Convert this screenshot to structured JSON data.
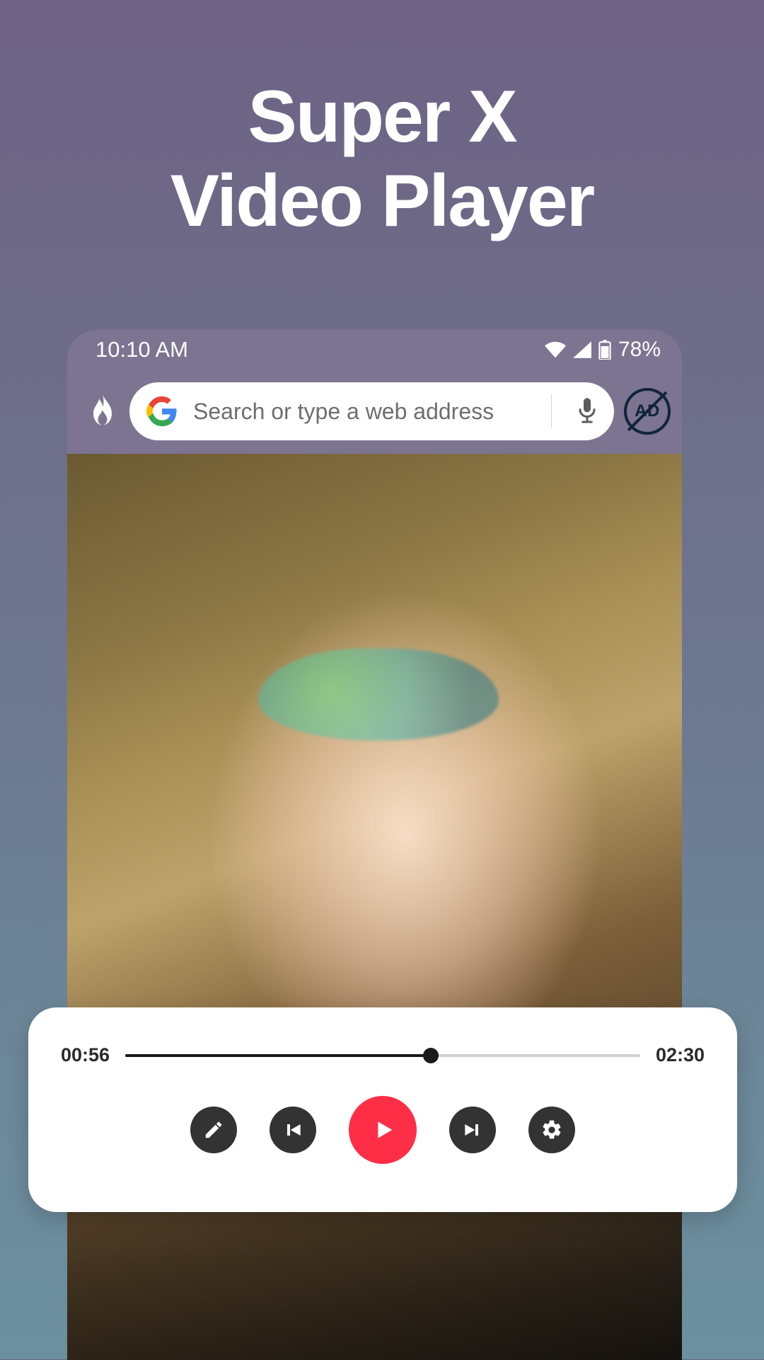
{
  "hero": {
    "title_line1": "Super X",
    "title_line2": "Video Player"
  },
  "statusbar": {
    "time": "10:10 AM",
    "battery_pct": "78%"
  },
  "browser": {
    "search_placeholder": "Search or type a web address",
    "ad_label": "AD",
    "g_label": "G"
  },
  "player": {
    "elapsed": "00:56",
    "total": "02:30",
    "progress_pct": 59.4
  },
  "colors": {
    "accent": "#ff2e47"
  }
}
